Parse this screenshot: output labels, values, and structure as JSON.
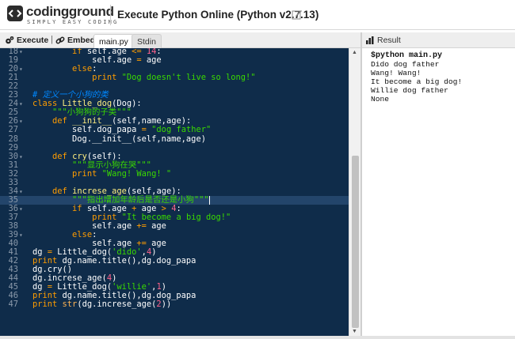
{
  "header": {
    "logo_text": "codingground",
    "logo_sub": "SIMPLY EASY CODING",
    "title": "Execute Python Online (Python v2.7.13)"
  },
  "toolbar": {
    "execute_label": "Execute",
    "separator": "|",
    "embed_label": "Embed",
    "tabs": [
      {
        "label": "main.py",
        "active": true
      },
      {
        "label": "Stdin",
        "active": false
      }
    ]
  },
  "result_panel": {
    "title": "Result",
    "command": "$python main.py",
    "output": [
      "Dido dog father",
      "Wang! Wang!",
      "It become a big dog!",
      "Willie dog father",
      "None"
    ]
  },
  "editor": {
    "cursor_line": 35,
    "lines": [
      {
        "n": "18",
        "fold": true,
        "segs": [
          [
            "",
            "        "
          ],
          [
            "kw",
            "if"
          ],
          [
            "",
            " self.age "
          ],
          [
            "op",
            "<="
          ],
          [
            "",
            " "
          ],
          [
            "nu",
            "14"
          ],
          [
            "",
            ":"
          ]
        ]
      },
      {
        "n": "19",
        "fold": false,
        "segs": [
          [
            "",
            "            self.age "
          ],
          [
            "op",
            "="
          ],
          [
            "",
            " age"
          ]
        ]
      },
      {
        "n": "20",
        "fold": true,
        "segs": [
          [
            "",
            "        "
          ],
          [
            "kw",
            "else"
          ],
          [
            "",
            ":"
          ]
        ]
      },
      {
        "n": "21",
        "fold": false,
        "segs": [
          [
            "",
            "            "
          ],
          [
            "kw",
            "print"
          ],
          [
            "",
            " "
          ],
          [
            "st",
            "\"Dog doesn't live so long!\""
          ]
        ]
      },
      {
        "n": "22",
        "fold": false,
        "segs": [
          [
            "",
            ""
          ]
        ]
      },
      {
        "n": "23",
        "fold": false,
        "segs": [
          [
            "cm",
            "# 定义一个小狗的类"
          ]
        ]
      },
      {
        "n": "24",
        "fold": true,
        "segs": [
          [
            "kw",
            "class"
          ],
          [
            "",
            " "
          ],
          [
            "fn",
            "Little_dog"
          ],
          [
            "",
            "(Dog):"
          ]
        ]
      },
      {
        "n": "25",
        "fold": false,
        "segs": [
          [
            "",
            "    "
          ],
          [
            "st",
            "\"\"\"小狗狗的子类\"\"\""
          ]
        ]
      },
      {
        "n": "26",
        "fold": true,
        "segs": [
          [
            "",
            "    "
          ],
          [
            "kw",
            "def"
          ],
          [
            "",
            " "
          ],
          [
            "fn",
            "__init__"
          ],
          [
            "",
            "(self,name,age):"
          ]
        ]
      },
      {
        "n": "27",
        "fold": false,
        "segs": [
          [
            "",
            "        self.dog_papa "
          ],
          [
            "op",
            "="
          ],
          [
            "",
            " "
          ],
          [
            "st",
            "\"dog father\""
          ]
        ]
      },
      {
        "n": "28",
        "fold": false,
        "segs": [
          [
            "",
            "        Dog.__init__(self,name,age)"
          ]
        ]
      },
      {
        "n": "29",
        "fold": false,
        "segs": [
          [
            "",
            ""
          ]
        ]
      },
      {
        "n": "30",
        "fold": true,
        "segs": [
          [
            "",
            "    "
          ],
          [
            "kw",
            "def"
          ],
          [
            "",
            " "
          ],
          [
            "fn",
            "cry"
          ],
          [
            "",
            "(self):"
          ]
        ]
      },
      {
        "n": "31",
        "fold": false,
        "segs": [
          [
            "",
            "        "
          ],
          [
            "st",
            "\"\"\"显示小狗在哭\"\"\""
          ]
        ]
      },
      {
        "n": "32",
        "fold": false,
        "segs": [
          [
            "",
            "        "
          ],
          [
            "kw",
            "print"
          ],
          [
            "",
            " "
          ],
          [
            "st",
            "\"Wang! Wang! \""
          ]
        ]
      },
      {
        "n": "33",
        "fold": false,
        "segs": [
          [
            "",
            ""
          ]
        ]
      },
      {
        "n": "34",
        "fold": true,
        "segs": [
          [
            "",
            "    "
          ],
          [
            "kw",
            "def"
          ],
          [
            "",
            " "
          ],
          [
            "fn",
            "increse_age"
          ],
          [
            "",
            "(self,age):"
          ]
        ]
      },
      {
        "n": "35",
        "fold": false,
        "segs": [
          [
            "",
            "        "
          ],
          [
            "st",
            "\"\"\"指出增加年龄后是否还是小狗\"\"\""
          ]
        ]
      },
      {
        "n": "36",
        "fold": true,
        "segs": [
          [
            "",
            "        "
          ],
          [
            "kw",
            "if"
          ],
          [
            "",
            " self.age "
          ],
          [
            "op",
            "+"
          ],
          [
            "",
            " age "
          ],
          [
            "op",
            ">"
          ],
          [
            "",
            " "
          ],
          [
            "nu",
            "4"
          ],
          [
            "",
            ":"
          ]
        ]
      },
      {
        "n": "37",
        "fold": false,
        "segs": [
          [
            "",
            "            "
          ],
          [
            "kw",
            "print"
          ],
          [
            "",
            " "
          ],
          [
            "st",
            "\"It become a big dog!\""
          ]
        ]
      },
      {
        "n": "38",
        "fold": false,
        "segs": [
          [
            "",
            "            self.age "
          ],
          [
            "op",
            "+="
          ],
          [
            "",
            " age"
          ]
        ]
      },
      {
        "n": "39",
        "fold": true,
        "segs": [
          [
            "",
            "        "
          ],
          [
            "kw",
            "else"
          ],
          [
            "",
            ":"
          ]
        ]
      },
      {
        "n": "40",
        "fold": false,
        "segs": [
          [
            "",
            "            self.age "
          ],
          [
            "op",
            "+="
          ],
          [
            "",
            " age"
          ]
        ]
      },
      {
        "n": "41",
        "fold": false,
        "segs": [
          [
            "",
            "dg "
          ],
          [
            "op",
            "="
          ],
          [
            "",
            " Little_dog("
          ],
          [
            "st",
            "'dido'"
          ],
          [
            "",
            ","
          ],
          [
            "nu",
            "4"
          ],
          [
            "",
            ")"
          ]
        ]
      },
      {
        "n": "42",
        "fold": false,
        "segs": [
          [
            "kw",
            "print"
          ],
          [
            "",
            " dg.name.title(),dg.dog_papa"
          ]
        ]
      },
      {
        "n": "43",
        "fold": false,
        "segs": [
          [
            "",
            "dg.cry()"
          ]
        ]
      },
      {
        "n": "44",
        "fold": false,
        "segs": [
          [
            "",
            "dg.increse_age("
          ],
          [
            "nu",
            "4"
          ],
          [
            "",
            ")"
          ]
        ]
      },
      {
        "n": "45",
        "fold": false,
        "segs": [
          [
            "",
            "dg "
          ],
          [
            "op",
            "="
          ],
          [
            "",
            " Little_dog("
          ],
          [
            "st",
            "'willie'"
          ],
          [
            "",
            ","
          ],
          [
            "nu",
            "1"
          ],
          [
            "",
            ")"
          ]
        ]
      },
      {
        "n": "46",
        "fold": false,
        "segs": [
          [
            "kw",
            "print"
          ],
          [
            "",
            " dg.name.title(),dg.dog_papa"
          ]
        ]
      },
      {
        "n": "47",
        "fold": false,
        "segs": [
          [
            "kw",
            "print"
          ],
          [
            "",
            " "
          ],
          [
            "nb",
            "str"
          ],
          [
            "",
            "(dg.increse_age("
          ],
          [
            "nu",
            "2"
          ],
          [
            "",
            "))"
          ]
        ]
      }
    ]
  },
  "icons": {
    "execute": "gears-icon",
    "embed": "link-icon",
    "result": "bar-chart-icon",
    "edit": "edit-icon"
  }
}
